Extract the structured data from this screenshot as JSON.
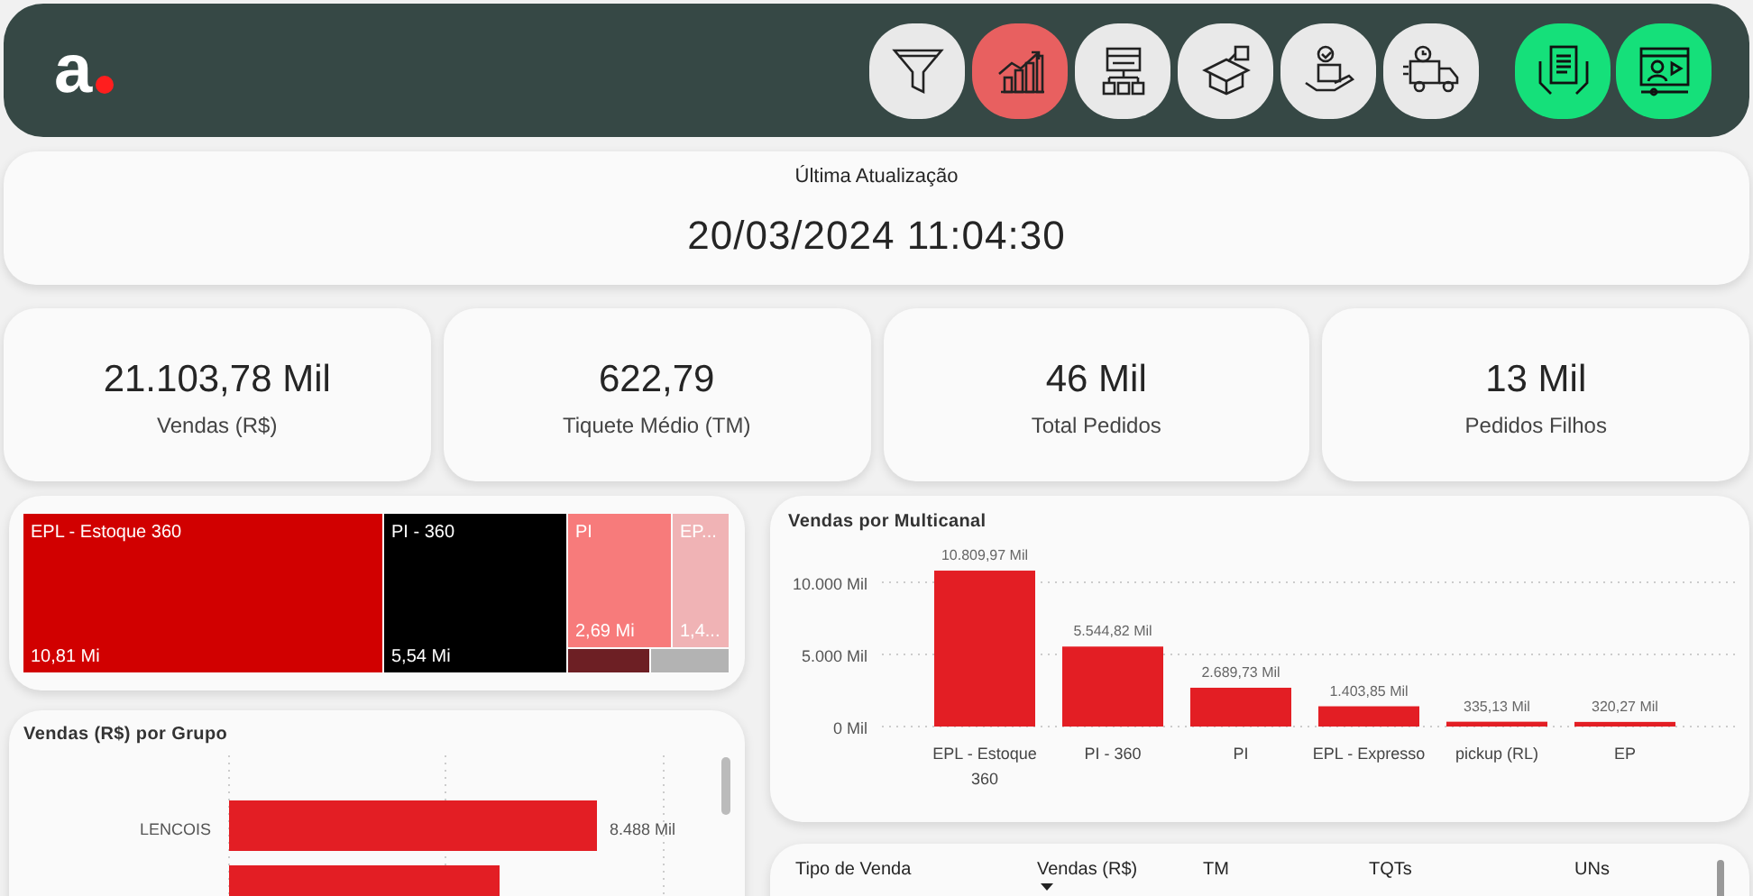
{
  "header": {
    "logo": {
      "text": "a"
    },
    "nav_buttons": [
      {
        "selected": false
      },
      {
        "selected": true
      },
      {
        "selected": false
      },
      {
        "selected": false
      },
      {
        "selected": false
      },
      {
        "selected": false
      }
    ],
    "action_buttons": [
      {
        "kind": "report"
      },
      {
        "kind": "video"
      }
    ]
  },
  "last_update": {
    "label": "Última Atualização",
    "value": "20/03/2024 11:04:30"
  },
  "kpis": [
    {
      "value": "21.103,78 Mil",
      "label": "Vendas (R$)"
    },
    {
      "value": "622,79",
      "label": "Tiquete Médio (TM)"
    },
    {
      "value": "46 Mil",
      "label": "Total Pedidos"
    },
    {
      "value": "13 Mil",
      "label": "Pedidos Filhos"
    }
  ],
  "treemap": {
    "tiles": [
      {
        "label": "EPL - Estoque 360",
        "value": "10,81 Mi",
        "color": "#d10000"
      },
      {
        "label": "PI - 360",
        "value": "5,54 Mi",
        "color": "#000000"
      },
      {
        "label": "PI",
        "value": "2,69 Mi",
        "color": "#f77b7b"
      },
      {
        "label": "EP...",
        "value": "1,4...",
        "color": "#f0b3b5"
      },
      {
        "color": "#6d1f24"
      },
      {
        "color": "#b3b3b3"
      }
    ]
  },
  "group_chart": {
    "title": "Vendas (R$) por Grupo",
    "rows": [
      {
        "label": "LENCOIS",
        "value": "8.488 Mil"
      }
    ]
  },
  "channel_chart": {
    "chart_data": {
      "type": "bar",
      "title": "Vendas por Multicanal",
      "categories": [
        "EPL - Estoque 360",
        "PI - 360",
        "PI",
        "EPL - Expresso",
        "pickup (RL)",
        "EP"
      ],
      "values": [
        10809.97,
        5544.82,
        2689.73,
        1403.85,
        335.13,
        320.27
      ],
      "value_labels": [
        "10.809,97 Mil",
        "5.544,82 Mil",
        "2.689,73 Mil",
        "1.403,85 Mil",
        "335,13 Mil",
        "320,27 Mil"
      ],
      "ylim": [
        0,
        11000
      ],
      "yticks": [
        {
          "value": 0,
          "label": "0 Mil"
        },
        {
          "value": 5000,
          "label": "5.000 Mil"
        },
        {
          "value": 10000,
          "label": "10.000 Mil"
        }
      ],
      "data_labels": true
    }
  },
  "sales_table": {
    "columns": [
      {
        "label": "Tipo de Venda",
        "sorted": false
      },
      {
        "label": "Vendas (R$)",
        "sorted": true
      },
      {
        "label": "TM",
        "sorted": false
      },
      {
        "label": "TQTs",
        "sorted": false
      },
      {
        "label": "UNs",
        "sorted": false
      }
    ]
  }
}
